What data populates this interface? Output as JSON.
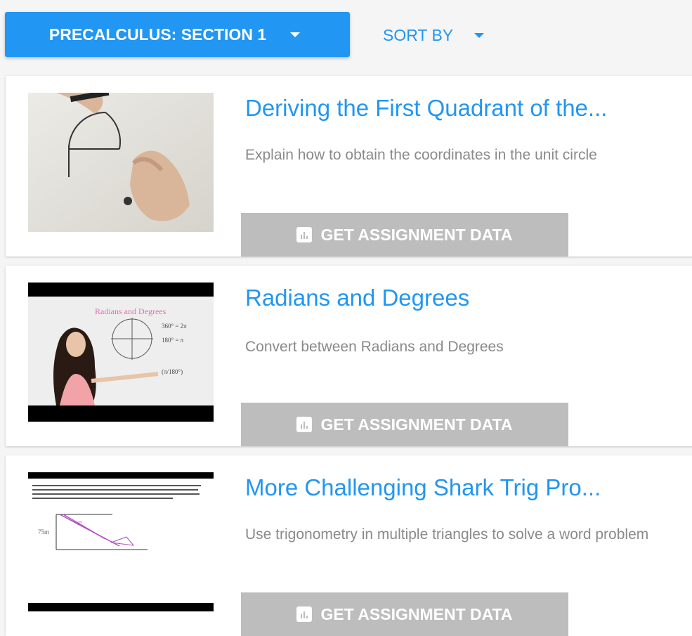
{
  "toolbar": {
    "section_label": "PRECALCULUS: SECTION 1",
    "sort_label": "SORT BY"
  },
  "colors": {
    "accent": "#2196f3",
    "button_grey": "#bdbdbd",
    "description": "#8a8a8a"
  },
  "lessons": [
    {
      "title": "Deriving the First Quadrant of the...",
      "description": "Explain how to obtain the coordinates in the unit circle",
      "button_label": "GET ASSIGNMENT DATA",
      "button_icon": "bar-chart-icon"
    },
    {
      "title": "Radians and Degrees",
      "description": "Convert between Radians and Degrees",
      "button_label": "GET ASSIGNMENT DATA",
      "button_icon": "bar-chart-icon"
    },
    {
      "title": "More Challenging Shark Trig Pro...",
      "description": "Use trigonometry in multiple triangles to solve a word problem",
      "button_label": "GET ASSIGNMENT DATA",
      "button_icon": "bar-chart-icon"
    }
  ]
}
